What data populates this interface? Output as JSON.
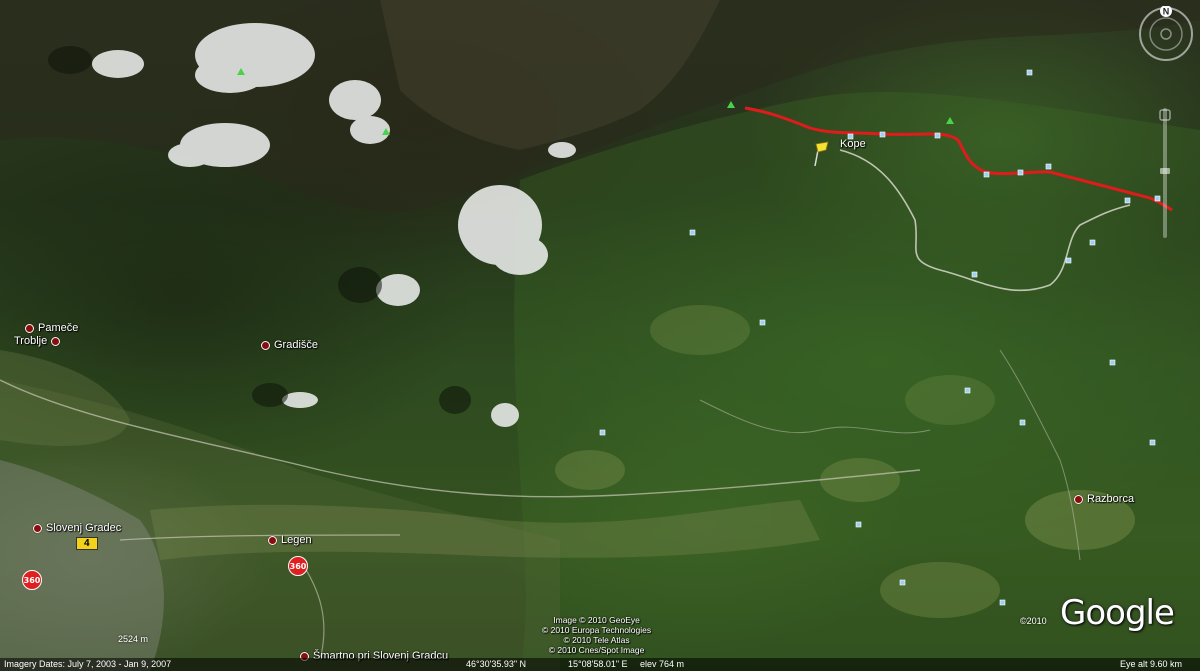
{
  "map": {
    "type": "satellite-3d",
    "colors": {
      "route": "#e01b1b",
      "pin": "#f7e034",
      "place_dot": "#8a0d0d",
      "badge": "#e02020",
      "road_sign": "#f2d21a",
      "peak": "#4ad24a"
    }
  },
  "places": {
    "kope": "Kope",
    "pamece": "Pameče",
    "troblje": "Troblje",
    "gradisce": "Gradišče",
    "slovenj_gradec": "Slovenj Gradec",
    "legen": "Legen",
    "razborca": "Razborca",
    "smartno": "Šmartno pri Slovenj Gradcu"
  },
  "road_sign": "4",
  "badge": "360",
  "controls": {
    "compass_label": "N"
  },
  "attribution": {
    "lines": [
      "Image © 2010 GeoEye",
      "© 2010 Europa Technologies",
      "© 2010 Tele Atlas",
      "© 2010 Cnes/Spot Image"
    ],
    "copyright_year": "©2010",
    "logo": "Google"
  },
  "scale_bar": "2524 m",
  "status": {
    "imagery_dates": "Imagery Dates: July 7, 2003 - Jan 9, 2007",
    "latitude": "46°30'35.93\" N",
    "longitude": "15°08'58.01\" E",
    "elevation": "elev  764 m",
    "eye_altitude": "Eye alt    9.60 km"
  }
}
